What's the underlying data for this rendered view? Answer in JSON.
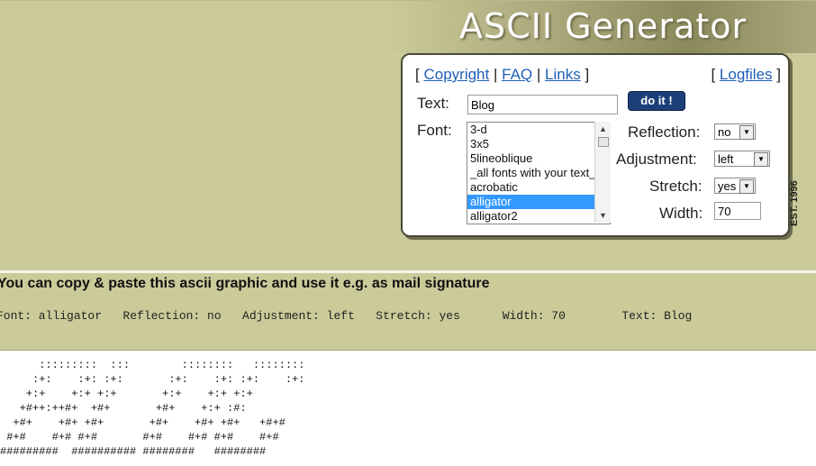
{
  "header": {
    "title": "ASCII Generator",
    "est": "EST. 1996"
  },
  "nav": {
    "copyright": "Copyright",
    "faq": "FAQ",
    "links": "Links",
    "logfiles": "Logfiles",
    "bracket_open": "[",
    "bracket_close": "]",
    "sep": "|"
  },
  "form": {
    "text_label": "Text:",
    "text_value": "Blog",
    "do_it_label": "do it !",
    "font_label": "Font:",
    "font_options": [
      "3-d",
      "3x5",
      "5lineoblique",
      "_all fonts with your text_",
      "acrobatic",
      "alligator",
      "alligator2"
    ],
    "selected_font": "alligator",
    "reflection_label": "Reflection:",
    "reflection_value": "no",
    "adjustment_label": "Adjustment:",
    "adjustment_value": "left",
    "stretch_label": "Stretch:",
    "stretch_value": "yes",
    "width_label": "Width:",
    "width_value": "70"
  },
  "result": {
    "headline": "You can copy & paste this ascii graphic and use it e.g. as mail signature",
    "info": "Font: alligator   Reflection: no   Adjustment: left   Stretch: yes      Width: 70        Text: Blog",
    "ascii": "      :::::::::  :::        ::::::::   ::::::::\n     :+:    :+: :+:       :+:    :+: :+:    :+:\n    +:+    +:+ +:+       +:+    +:+ +:+\n   +#++:++#+  +#+       +#+    +:+ :#:\n  +#+    +#+ +#+       +#+    +#+ +#+   +#+#\n #+#    #+# #+#       #+#    #+# #+#    #+#\n#########  ########## ########   ########"
  },
  "colors": {
    "background": "#cbcb9a",
    "link": "#1f5fb8",
    "button": "#1d3f78",
    "selection": "#3399ff"
  }
}
